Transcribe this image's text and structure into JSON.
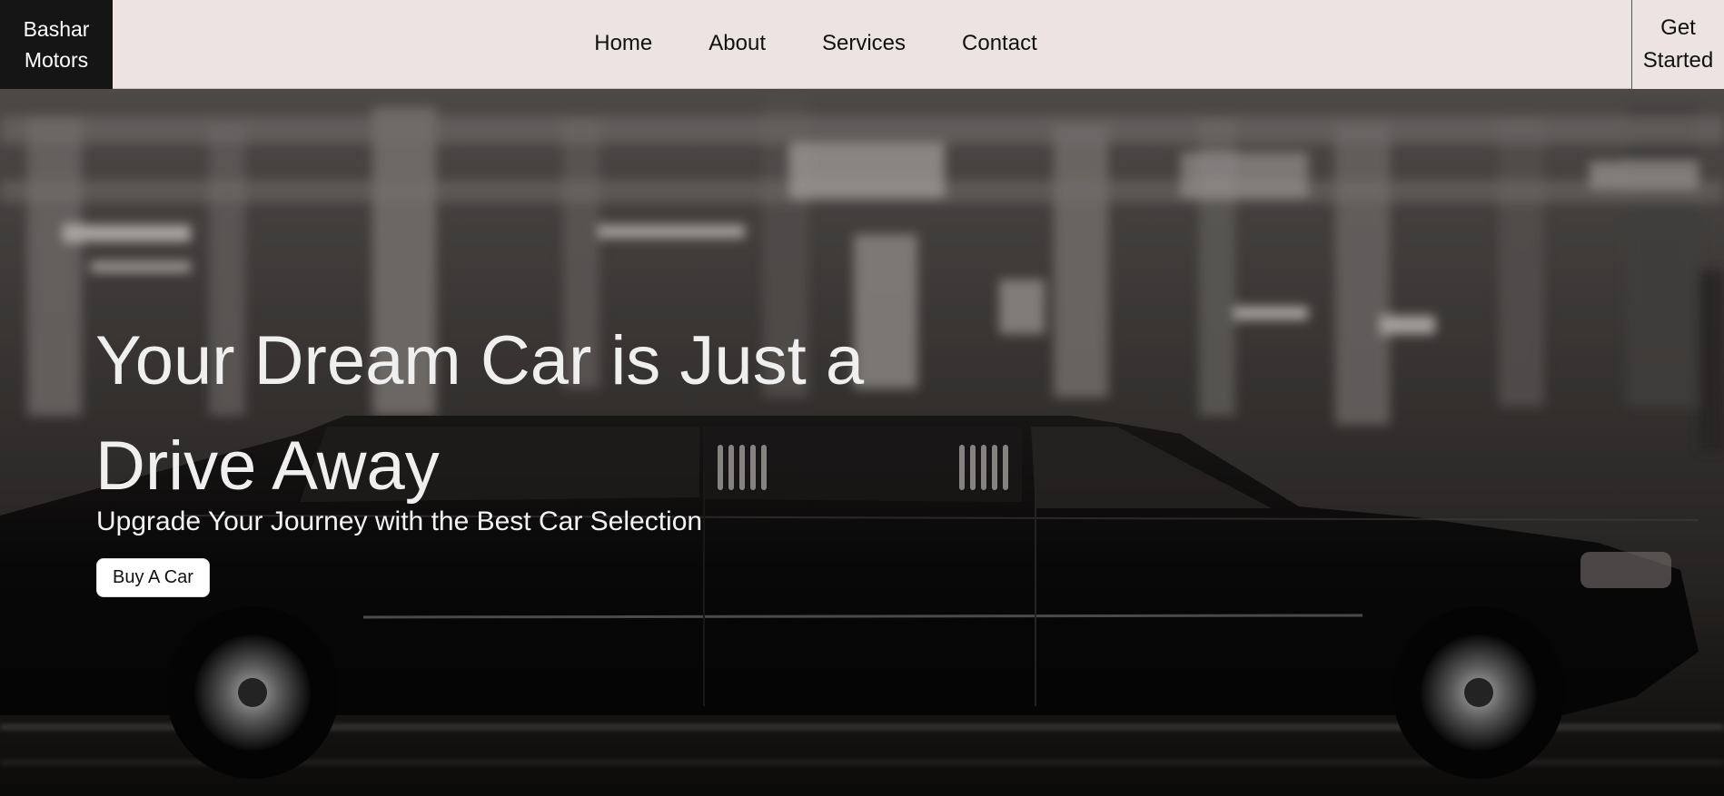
{
  "brand": {
    "line1": "Bashar",
    "line2": "Motors"
  },
  "nav": {
    "items": [
      {
        "label": "Home"
      },
      {
        "label": "About"
      },
      {
        "label": "Services"
      },
      {
        "label": "Contact"
      }
    ],
    "cta_line1": "Get",
    "cta_line2": "Started"
  },
  "hero": {
    "title_line1": "Your Dream Car is Just a",
    "title_line2": "Drive Away",
    "subtitle": "Upgrade Your Journey with the Best Car Selection",
    "button_label": "Buy A Car",
    "background_image": "limousine-night-street-photo"
  },
  "colors": {
    "header_bg": "#ede3e2",
    "logo_bg": "#151515",
    "hero_text": "#efefef",
    "button_bg": "#ffffff"
  }
}
